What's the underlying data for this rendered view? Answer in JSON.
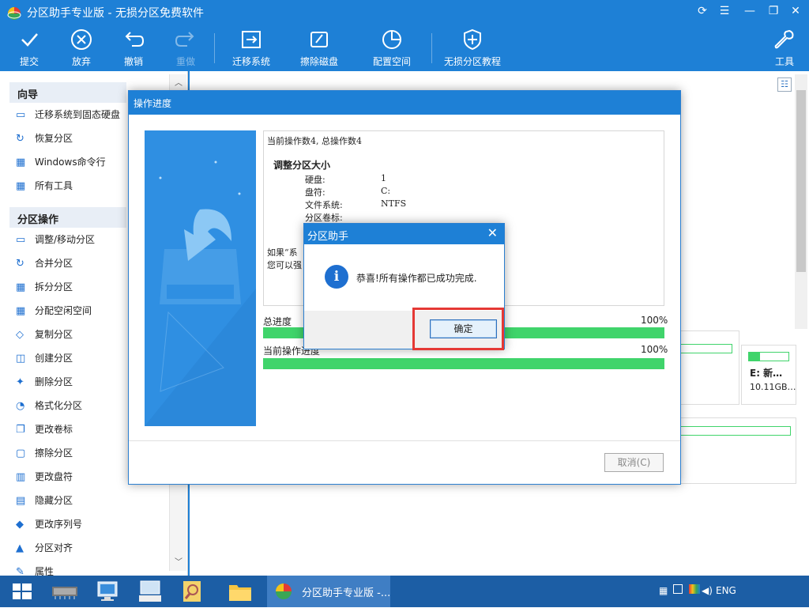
{
  "window": {
    "title": "分区助手专业版 - 无损分区免费软件"
  },
  "toolbar": {
    "commit": "提交",
    "discard": "放弃",
    "undo": "撤销",
    "redo": "重做",
    "migrate": "迁移系统",
    "wipe": "擦除磁盘",
    "allocate": "配置空间",
    "tutorial": "无损分区教程",
    "tools": "工具"
  },
  "sidebar": {
    "wizard_header": "向导",
    "wizard_items": [
      "迁移系统到固态硬盘",
      "恢复分区",
      "Windows命令行",
      "所有工具"
    ],
    "ops_header": "分区操作",
    "ops_items": [
      "调整/移动分区",
      "合并分区",
      "拆分分区",
      "分配空闲空间",
      "复制分区",
      "创建分区",
      "删除分区",
      "格式化分区",
      "更改卷标",
      "擦除分区",
      "更改盘符",
      "隐藏分区",
      "更改序列号",
      "分区对齐",
      "属性"
    ]
  },
  "disk_card": {
    "label": "E: 新…",
    "size": "10.11GB…"
  },
  "progress_dialog": {
    "title": "操作进度",
    "op_count": "当前操作数4, 总操作数4",
    "op_name": "调整分区大小",
    "rows": [
      {
        "k": "硬盘:",
        "v": "1"
      },
      {
        "k": "盘符:",
        "v": "C:"
      },
      {
        "k": "文件系统:",
        "v": "NTFS"
      },
      {
        "k": "分区卷标:",
        "v": ""
      }
    ],
    "note_line1": "如果“系",
    "note_line2": "您可以强",
    "total_label": "总进度",
    "total_pct": "100%",
    "total_value": 1.0,
    "current_label": "当前操作进度",
    "current_pct": "100%",
    "current_value": 1.0,
    "cancel": "取消(C)"
  },
  "message_dialog": {
    "title": "分区助手",
    "close": "✕",
    "message": "恭喜!所有操作都已成功完成.",
    "ok": "确定"
  },
  "taskbar": {
    "app_title": "分区助手专业版 -...",
    "lang": "ENG"
  },
  "colors": {
    "primary": "#1e80d6",
    "progress_green": "#40d46b",
    "highlight_red": "#e53935",
    "taskbar": "#1c5ea5"
  }
}
